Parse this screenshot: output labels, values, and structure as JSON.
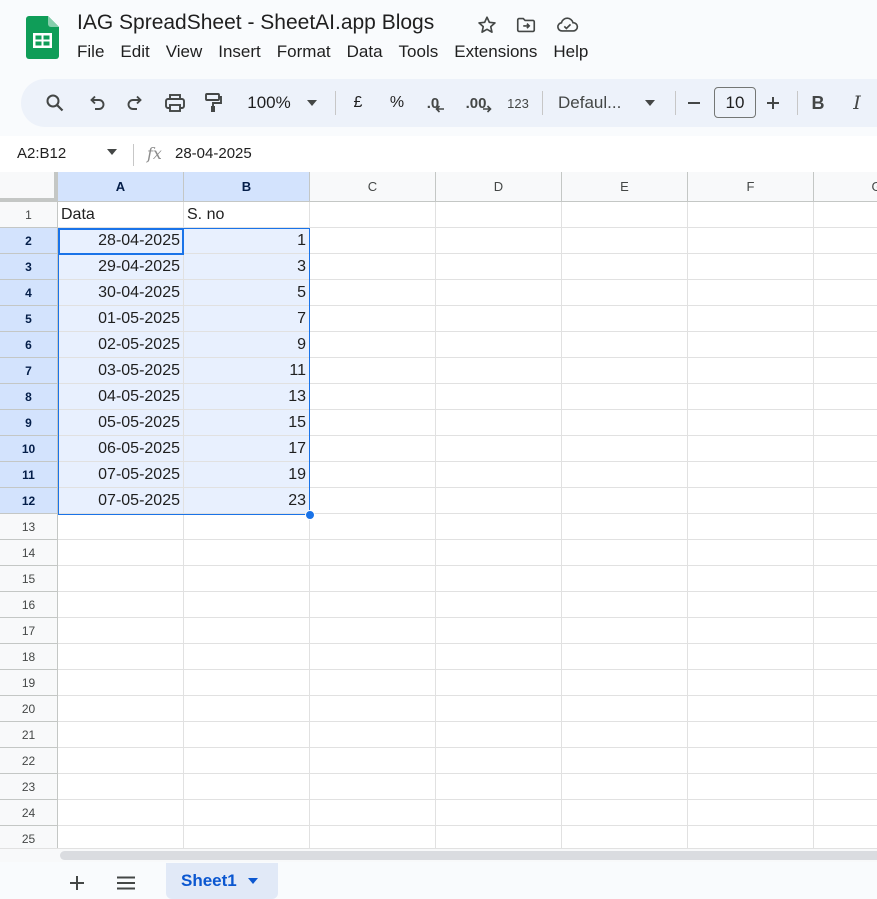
{
  "app": {
    "title": "IAG SpreadSheet - SheetAI.app Blogs",
    "brand_color": "#0f9d58",
    "accent_color": "#1a73e8"
  },
  "menu": [
    "File",
    "Edit",
    "View",
    "Insert",
    "Format",
    "Data",
    "Tools",
    "Extensions",
    "Help"
  ],
  "toolbar": {
    "zoom": "100%",
    "currency": "£",
    "percent": "%",
    "decrease_decimal": ".0",
    "increase_decimal": ".00",
    "number_format": "123",
    "font_family": "Defaul...",
    "font_size": "10",
    "bold": "B",
    "italic": "I",
    "icons": [
      "search-icon",
      "undo-icon",
      "redo-icon",
      "print-icon",
      "paint-format-icon",
      "chevron-down-icon",
      "minus-icon",
      "plus-icon"
    ]
  },
  "formula_bar": {
    "name_box": "A2:B12",
    "fx": "fx",
    "value": "28-04-2025"
  },
  "columns": [
    "A",
    "B",
    "C",
    "D",
    "E",
    "F",
    "G"
  ],
  "selected_columns": [
    "A",
    "B"
  ],
  "rows": [
    {
      "n": "1",
      "a": "Data",
      "b": "S. no"
    },
    {
      "n": "2",
      "a": "28-04-2025",
      "b": "1"
    },
    {
      "n": "3",
      "a": "29-04-2025",
      "b": "3"
    },
    {
      "n": "4",
      "a": "30-04-2025",
      "b": "5"
    },
    {
      "n": "5",
      "a": "01-05-2025",
      "b": "7"
    },
    {
      "n": "6",
      "a": "02-05-2025",
      "b": "9"
    },
    {
      "n": "7",
      "a": "03-05-2025",
      "b": "11"
    },
    {
      "n": "8",
      "a": "04-05-2025",
      "b": "13"
    },
    {
      "n": "9",
      "a": "05-05-2025",
      "b": "15"
    },
    {
      "n": "10",
      "a": "06-05-2025",
      "b": "17"
    },
    {
      "n": "11",
      "a": "07-05-2025",
      "b": "19"
    },
    {
      "n": "12",
      "a": "07-05-2025",
      "b": "23"
    },
    {
      "n": "13",
      "a": "",
      "b": ""
    },
    {
      "n": "14",
      "a": "",
      "b": ""
    },
    {
      "n": "15",
      "a": "",
      "b": ""
    },
    {
      "n": "16",
      "a": "",
      "b": ""
    },
    {
      "n": "17",
      "a": "",
      "b": ""
    },
    {
      "n": "18",
      "a": "",
      "b": ""
    },
    {
      "n": "19",
      "a": "",
      "b": ""
    },
    {
      "n": "20",
      "a": "",
      "b": ""
    },
    {
      "n": "21",
      "a": "",
      "b": ""
    },
    {
      "n": "22",
      "a": "",
      "b": ""
    },
    {
      "n": "23",
      "a": "",
      "b": ""
    },
    {
      "n": "24",
      "a": "",
      "b": ""
    },
    {
      "n": "25",
      "a": "",
      "b": ""
    }
  ],
  "sheets": [
    {
      "label": "Sheet1",
      "active": true
    }
  ]
}
